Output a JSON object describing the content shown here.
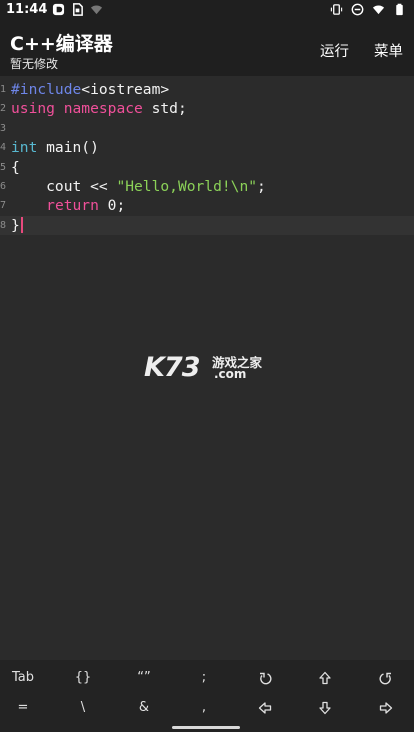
{
  "status_bar": {
    "time": "11:44",
    "left_icons": [
      "notification-app-icon",
      "sim-card-icon",
      "wifi-question-icon"
    ],
    "right_icons": [
      "vibrate-icon",
      "do-not-disturb-icon",
      "wifi-icon",
      "battery-icon"
    ]
  },
  "app_bar": {
    "title": "C++编译器",
    "subtitle": "暂无修改",
    "actions": {
      "run": "运行",
      "menu": "菜单"
    }
  },
  "editor": {
    "lines": [
      {
        "num": "1",
        "tokens": [
          {
            "t": "#include",
            "type": "preproc"
          },
          {
            "t": "<iostream>",
            "type": "plain"
          }
        ]
      },
      {
        "num": "2",
        "tokens": [
          {
            "t": "using",
            "type": "keyword"
          },
          {
            "t": " ",
            "type": "plain"
          },
          {
            "t": "namespace",
            "type": "keyword"
          },
          {
            "t": " std;",
            "type": "plain"
          }
        ]
      },
      {
        "num": "3",
        "tokens": []
      },
      {
        "num": "4",
        "tokens": [
          {
            "t": "int",
            "type": "type"
          },
          {
            "t": " main()",
            "type": "plain"
          }
        ]
      },
      {
        "num": "5",
        "tokens": [
          {
            "t": "{",
            "type": "plain"
          }
        ]
      },
      {
        "num": "6",
        "tokens": [
          {
            "t": "    cout << ",
            "type": "plain"
          },
          {
            "t": "\"Hello,World!\\n\"",
            "type": "string"
          },
          {
            "t": ";",
            "type": "plain"
          }
        ]
      },
      {
        "num": "7",
        "tokens": [
          {
            "t": "    ",
            "type": "plain"
          },
          {
            "t": "return",
            "type": "keyword"
          },
          {
            "t": " 0;",
            "type": "plain"
          }
        ]
      },
      {
        "num": "8",
        "tokens": [
          {
            "t": "}",
            "type": "plain"
          }
        ],
        "current": true
      }
    ]
  },
  "watermark": {
    "logo": "K73",
    "text": "游戏之家",
    "domain": ".com"
  },
  "symbol_bar": {
    "row1": [
      {
        "label": "Tab"
      },
      {
        "label": "{}"
      },
      {
        "label": "“”"
      },
      {
        "label": ";"
      },
      {
        "icon": "undo-icon"
      },
      {
        "icon": "arrow-up-icon"
      },
      {
        "icon": "redo-icon"
      }
    ],
    "row2": [
      {
        "label": "="
      },
      {
        "label": "\\"
      },
      {
        "label": "&"
      },
      {
        "label": ","
      },
      {
        "icon": "arrow-left-icon"
      },
      {
        "icon": "arrow-down-icon"
      },
      {
        "icon": "arrow-right-icon"
      }
    ]
  },
  "colors": {
    "background": "#2b2b2b",
    "app_bar": "#1f1f1f",
    "preproc": "#6e86e8",
    "keyword": "#f0509a",
    "type": "#58b8d0",
    "string": "#8bd158",
    "cursor": "#e8497d"
  }
}
